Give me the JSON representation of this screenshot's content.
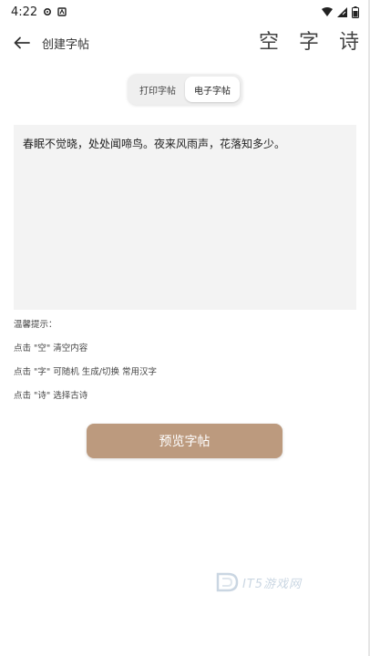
{
  "status_bar": {
    "time": "4:22"
  },
  "header": {
    "title": "创建字帖",
    "actions": [
      {
        "label": "空"
      },
      {
        "label": "字"
      },
      {
        "label": "诗"
      }
    ]
  },
  "mode_toggle": {
    "options": [
      {
        "label": "打印字帖",
        "active": false
      },
      {
        "label": "电子字帖",
        "active": true
      }
    ]
  },
  "editor": {
    "value": "春眠不觉晓，处处闻啼鸟。夜来风雨声，花落知多少。"
  },
  "tips": {
    "title": "温馨提示：",
    "lines": [
      "点击 \"空\" 清空内容",
      "点击 \"字\" 可随机 生成/切换 常用汉字",
      "点击 \"诗\" 选择古诗"
    ]
  },
  "preview_button": {
    "label": "预览字帖"
  },
  "watermark": {
    "text": "IT5游戏网"
  },
  "colors": {
    "accent": "#bc9a7e",
    "editor_bg": "#f3f3f3"
  }
}
